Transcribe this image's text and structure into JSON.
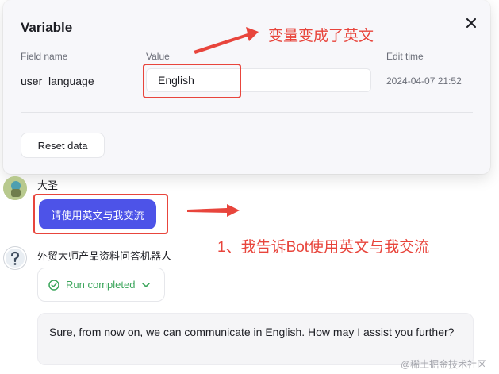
{
  "popover": {
    "title": "Variable",
    "columns": {
      "field_name": "Field name",
      "value": "Value",
      "edit_time": "Edit time"
    },
    "row": {
      "field_name": "user_language",
      "value": "English",
      "edit_time": "2024-04-07 21:52"
    },
    "reset_label": "Reset data",
    "close_icon": "close-icon"
  },
  "annotations": {
    "top_note": "变量变成了英文",
    "bottom_note": "1、我告诉Bot使用英文与我交流",
    "color": "#e8453c"
  },
  "chat": {
    "user": {
      "name": "大圣",
      "message": "请使用英文与我交流"
    },
    "bot": {
      "name": "外贸大师产品资料问答机器人",
      "run_status": "Run completed",
      "reply": "Sure, from now on, we can communicate in English. How may I assist you further?"
    }
  },
  "watermark": "@稀土掘金技术社区",
  "colors": {
    "primary": "#4d53e8",
    "success": "#3ca65c",
    "annotation": "#e8453c"
  }
}
